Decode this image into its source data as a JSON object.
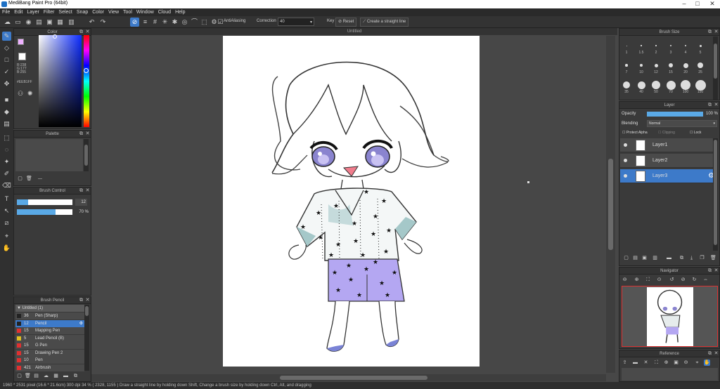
{
  "window": {
    "title": "MediBang Paint Pro (64bit)",
    "minimize": "–",
    "maximize": "□",
    "close": "✕"
  },
  "menu": [
    "File",
    "Edit",
    "Layer",
    "Filter",
    "Select",
    "Snap",
    "Color",
    "View",
    "Tool",
    "Window",
    "Cloud",
    "Help"
  ],
  "toolbar": {
    "antialias_label": "AntiAliasing",
    "correction_label": "Correction",
    "correction_value": "40",
    "key_label": "Key",
    "reset_label": "Reset",
    "straight_line_label": "Create a straight line"
  },
  "color_panel": {
    "title": "Color",
    "r": "R:238",
    "g": "G:177",
    "b": "B:255",
    "hex": "#EEB1FF",
    "primary_color": "#eeb1ff",
    "secondary_color": "#ffffff"
  },
  "palette_panel": {
    "title": "Palette",
    "dash": "---"
  },
  "brush_control": {
    "title": "Brush Control",
    "size_value": "12",
    "size_fraction": 0.2,
    "opacity_value": "70 %",
    "opacity_fraction": 0.7
  },
  "brush_list": {
    "title": "Brush Pencil",
    "group": "Untitled (1)",
    "items": [
      {
        "num": "36",
        "name": "Pen (Sharp)",
        "color": "#222222"
      },
      {
        "num": "12",
        "name": "Pencil",
        "color": "#222222",
        "selected": true
      },
      {
        "num": "15",
        "name": "Mapping Pen",
        "color": "#e03030"
      },
      {
        "num": "5",
        "name": "Lead Pencil (B)",
        "color": "#e0c020"
      },
      {
        "num": "15",
        "name": "G Pen",
        "color": "#e03030"
      },
      {
        "num": "15",
        "name": "Drawing Pen 2",
        "color": "#e03030"
      },
      {
        "num": "10",
        "name": "Pen",
        "color": "#e03030"
      },
      {
        "num": "421",
        "name": "Airbrush",
        "color": "#e03030"
      }
    ]
  },
  "document": {
    "tab_title": "Untitled"
  },
  "brush_size_panel": {
    "title": "Brush Size",
    "labels": [
      "1",
      "1.5",
      "2",
      "3",
      "4",
      "5",
      "7",
      "10",
      "12",
      "15",
      "20",
      "25",
      "35",
      "40",
      "50",
      "70",
      "100",
      "150"
    ]
  },
  "layer_panel": {
    "title": "Layer",
    "opacity_label": "Opacity",
    "opacity_value": "100 %",
    "opacity_fraction": 1.0,
    "blending_label": "Blending",
    "blending_value": "Normal",
    "protect_alpha": "Protect Alpha",
    "clipping": "Clipping",
    "lock": "Lock",
    "layers": [
      "Layer1",
      "Layer2",
      "Layer3"
    ]
  },
  "navigator_panel": {
    "title": "Navigator"
  },
  "reference_panel": {
    "title": "Reference"
  },
  "status": {
    "text": "1960 * 2531 pixel  (16.6 * 21.6cm)  300 dpi  34 %  ( 2328, 1155 )  Draw a straight line by holding down Shift, Change a brush size by holding down Ctrl, Alt, and dragging"
  },
  "colors": {
    "accent": "#3d7ac9",
    "panel": "#3a3a3a",
    "canvas_bg": "#474747"
  }
}
